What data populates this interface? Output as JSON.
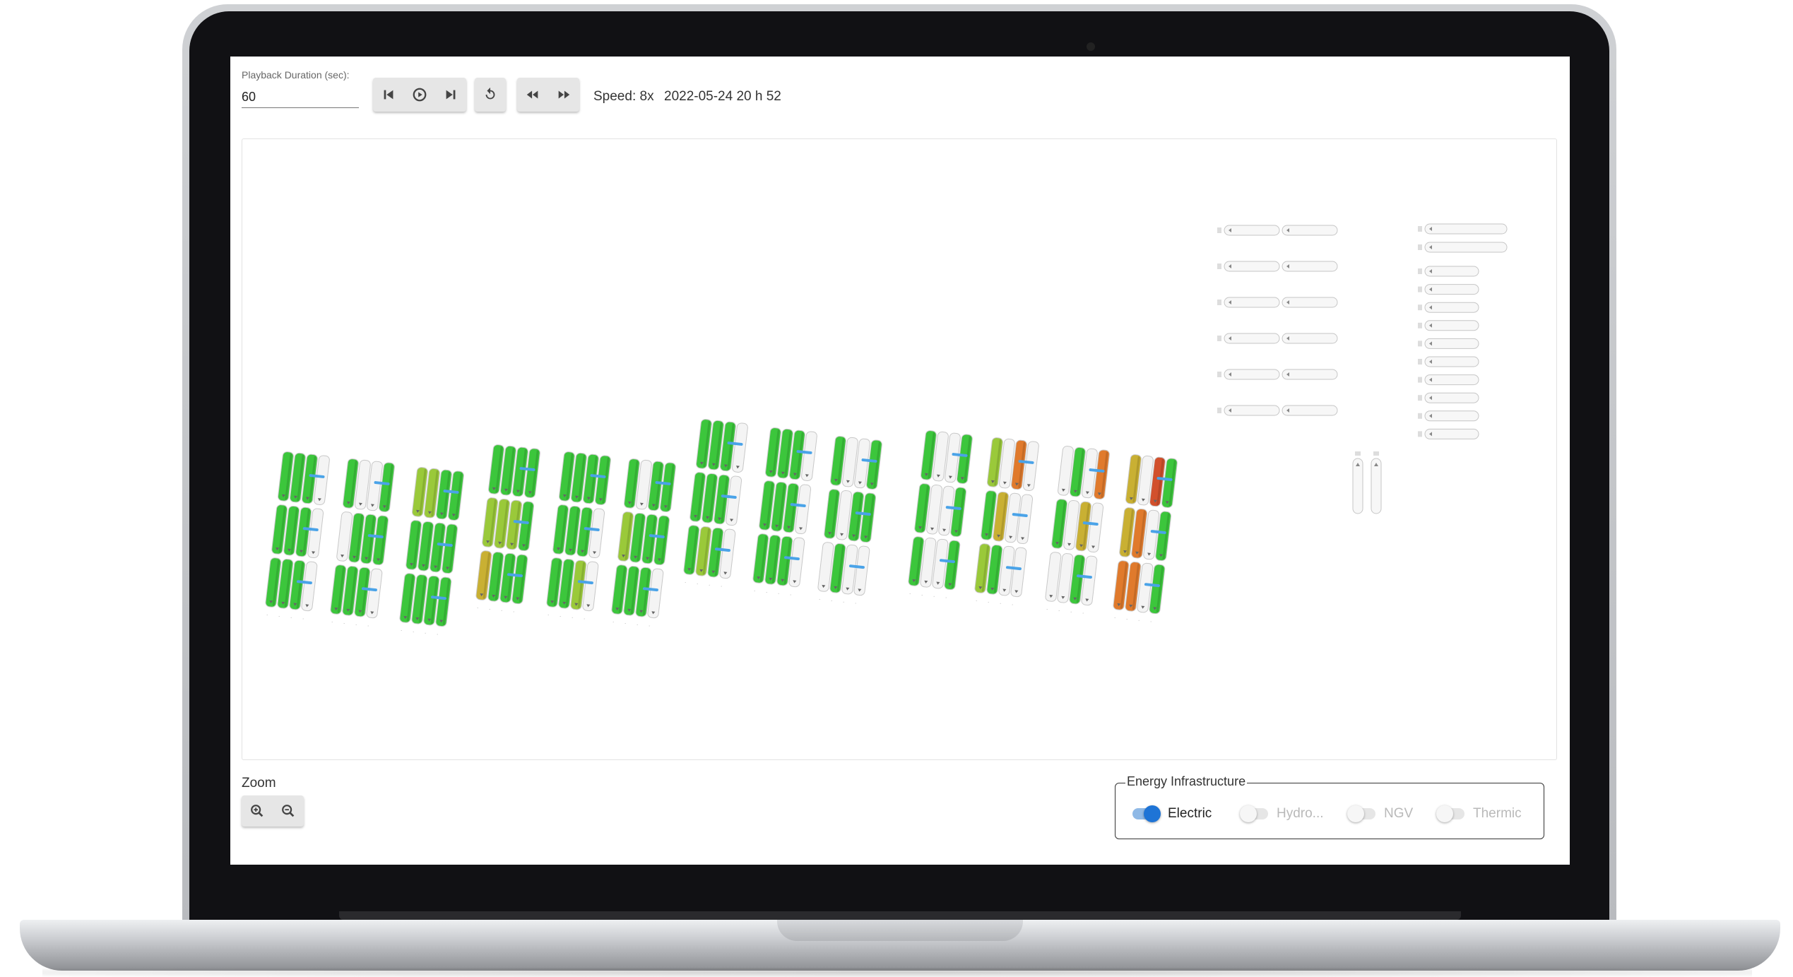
{
  "toolbar": {
    "duration_label": "Playback Duration (sec):",
    "duration_value": "60",
    "speed": "Speed: 8x",
    "datetime": "2022-05-24 20 h 52"
  },
  "icons": [
    "skip-previous-icon",
    "play-icon",
    "skip-next-icon",
    "replay-icon",
    "rewind-icon",
    "fast-forward-icon",
    "zoom-in-icon",
    "zoom-out-icon"
  ],
  "zoom": {
    "label": "Zoom"
  },
  "energy": {
    "legend": "Energy Infrastructure",
    "options": [
      {
        "label": "Electric",
        "on": true
      },
      {
        "label": "Hydro...",
        "on": false
      },
      {
        "label": "NGV",
        "on": false
      },
      {
        "label": "Thermic",
        "on": false
      }
    ]
  },
  "colors": {
    "green": "#3cc63c",
    "yellow_green": "#9ac93a",
    "mustard": "#c9b033",
    "orange": "#e07a2c",
    "red": "#d2502c",
    "empty": "#f4f4f4",
    "cable": "#4aa3e8",
    "toggle_on": "#1e74d6"
  },
  "parking_map": {
    "blocks": [
      {
        "label": "block-1",
        "rows": [
          [
            "g",
            "g",
            "g",
            "e"
          ],
          [
            "g",
            "g",
            "g",
            "e"
          ],
          [
            "g",
            "g",
            "g",
            "e"
          ]
        ]
      },
      {
        "label": "block-2",
        "rows": [
          [
            "g",
            "e",
            "e",
            "g"
          ],
          [
            "e",
            "g",
            "g",
            "g"
          ],
          [
            "g",
            "g",
            "g",
            "e"
          ]
        ]
      },
      {
        "label": "block-3",
        "rows": [
          [
            "y",
            "y",
            "g",
            "g"
          ],
          [
            "g",
            "g",
            "g",
            "g"
          ],
          [
            "g",
            "g",
            "g",
            "g"
          ]
        ]
      },
      {
        "label": "block-4",
        "rows": [
          [
            "g",
            "g",
            "g",
            "g"
          ],
          [
            "y",
            "y",
            "y",
            "g"
          ],
          [
            "m",
            "g",
            "g",
            "g"
          ]
        ]
      },
      {
        "label": "block-5",
        "rows": [
          [
            "g",
            "g",
            "g",
            "g"
          ],
          [
            "g",
            "g",
            "g",
            "e"
          ],
          [
            "g",
            "g",
            "y",
            "e"
          ]
        ]
      },
      {
        "label": "block-6",
        "rows": [
          [
            "g",
            "e",
            "g",
            "g"
          ],
          [
            "y",
            "g",
            "g",
            "g"
          ],
          [
            "g",
            "g",
            "g",
            "e"
          ]
        ]
      },
      {
        "label": "block-7",
        "rows": [
          [
            "g",
            "g",
            "g",
            "e"
          ],
          [
            "g",
            "g",
            "g",
            "e"
          ],
          [
            "g",
            "y",
            "g",
            "e"
          ]
        ]
      },
      {
        "label": "block-8",
        "rows": [
          [
            "g",
            "g",
            "g",
            "e"
          ],
          [
            "g",
            "g",
            "g",
            "e"
          ],
          [
            "g",
            "g",
            "g",
            "e"
          ]
        ]
      },
      {
        "label": "block-9",
        "rows": [
          [
            "g",
            "e",
            "e",
            "g"
          ],
          [
            "g",
            "e",
            "g",
            "g"
          ],
          [
            "e",
            "g",
            "e",
            "e"
          ]
        ]
      },
      {
        "label": "block-10",
        "rows": [
          [
            "g",
            "e",
            "e",
            "g"
          ],
          [
            "g",
            "e",
            "e",
            "g"
          ],
          [
            "g",
            "e",
            "e",
            "g"
          ]
        ]
      },
      {
        "label": "block-11",
        "rows": [
          [
            "y",
            "e",
            "o",
            "e"
          ],
          [
            "g",
            "m",
            "e",
            "e"
          ],
          [
            "y",
            "g",
            "e",
            "e"
          ]
        ]
      },
      {
        "label": "block-12",
        "rows": [
          [
            "e",
            "g",
            "e",
            "o"
          ],
          [
            "g",
            "e",
            "m",
            "e"
          ],
          [
            "e",
            "e",
            "g",
            "e"
          ]
        ]
      },
      {
        "label": "block-13",
        "rows": [
          [
            "m",
            "e",
            "r",
            "g"
          ],
          [
            "m",
            "o",
            "e",
            "g"
          ],
          [
            "o",
            "o",
            "e",
            "g"
          ]
        ]
      }
    ],
    "right_chargers_left_col": 12,
    "right_chargers_right_col": 12,
    "vertical_chargers": 2
  }
}
